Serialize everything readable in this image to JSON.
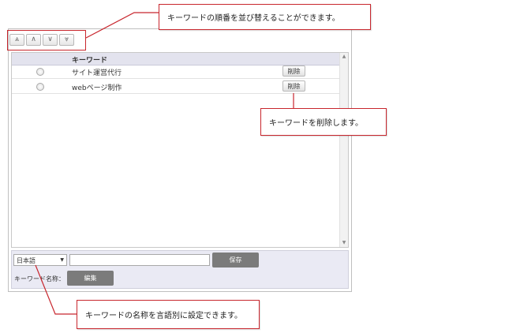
{
  "toolbar": {
    "buttons": [
      {
        "icon": "double-chevron-up-icon",
        "glyph": "⩓"
      },
      {
        "icon": "chevron-up-icon",
        "glyph": "∧"
      },
      {
        "icon": "chevron-down-icon",
        "glyph": "∨"
      },
      {
        "icon": "double-chevron-down-icon",
        "glyph": "⩔"
      }
    ]
  },
  "list": {
    "header_label": "キーワード",
    "rows": [
      {
        "text": "サイト運営代行",
        "delete_label": "削除"
      },
      {
        "text": "webページ制作",
        "delete_label": "削除"
      }
    ]
  },
  "bottom": {
    "language_value": "日本語",
    "name_input_value": "",
    "save_label": "保存",
    "keyword_name_label": "キーワード名称：",
    "edit_label": "編集"
  },
  "callouts": {
    "reorder": "キーワードの順番を並び替えることができます。",
    "delete": "キーワードを削除します。",
    "language": "キーワードの名称を言語別に設定できます。"
  },
  "colors": {
    "callout_border": "#c8262d",
    "header_bg": "#e3e3ee",
    "bottom_bg": "#eaeaf4",
    "button_dark": "#7b7b7b"
  }
}
